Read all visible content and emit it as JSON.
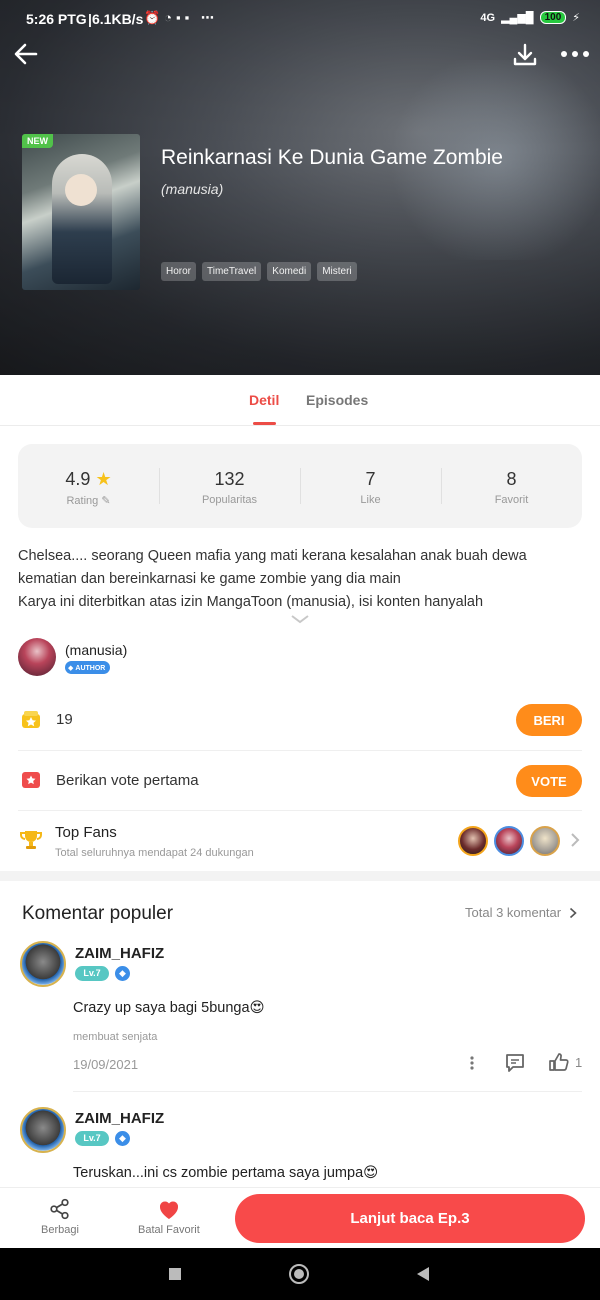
{
  "status_bar": {
    "time": "5:26 PTG",
    "speed": "6.1KB/s",
    "network": "4G",
    "battery": "100"
  },
  "header": {
    "cover_badge": "NEW",
    "title": "Reinkarnasi Ke Dunia Game Zombie",
    "author_line": "(manusia)",
    "tags": [
      "Horor",
      "TimeTravel",
      "Komedi",
      "Misteri"
    ]
  },
  "tabs": {
    "detail": "Detil",
    "episodes": "Episodes"
  },
  "stats": [
    {
      "value": "4.9",
      "label": "Rating"
    },
    {
      "value": "132",
      "label": "Popularitas"
    },
    {
      "value": "7",
      "label": "Like"
    },
    {
      "value": "8",
      "label": "Favorit"
    }
  ],
  "description": {
    "line1": "Chelsea.... seorang Queen mafia yang mati kerana kesalahan anak buah dewa",
    "line2": "kematian dan bereinkarnasi ke game zombie yang dia main",
    "line3": "Karya ini diterbitkan atas izin MangaToon (manusia), isi konten hanyalah"
  },
  "author": {
    "name": "(manusia)",
    "badge": "AUTHOR"
  },
  "gift": {
    "count": "19",
    "button": "BERI"
  },
  "vote": {
    "text": "Berikan vote pertama",
    "button": "VOTE"
  },
  "top_fans": {
    "title": "Top Fans",
    "subtitle": "Total seluruhnya mendapat 24 dukungan"
  },
  "comments": {
    "title": "Komentar populer",
    "total": "Total 3 komentar",
    "items": [
      {
        "user": "ZAIM_HAFIZ",
        "level": "Lv.7",
        "text": "Crazy up saya bagi 5bunga😍",
        "sub": "membuat senjata",
        "date": "19/09/2021",
        "likes": "1"
      },
      {
        "user": "ZAIM_HAFIZ",
        "level": "Lv.7",
        "text": "Teruskan...ini cs zombie pertama saya jumpa😍"
      }
    ]
  },
  "bottom_bar": {
    "share": "Berbagi",
    "unfavorite": "Batal Favorit",
    "read": "Lanjut baca Ep.3"
  },
  "colors": {
    "accent": "#ec4c46",
    "orange": "#ff8c1a",
    "read_button": "#f84a4a"
  }
}
